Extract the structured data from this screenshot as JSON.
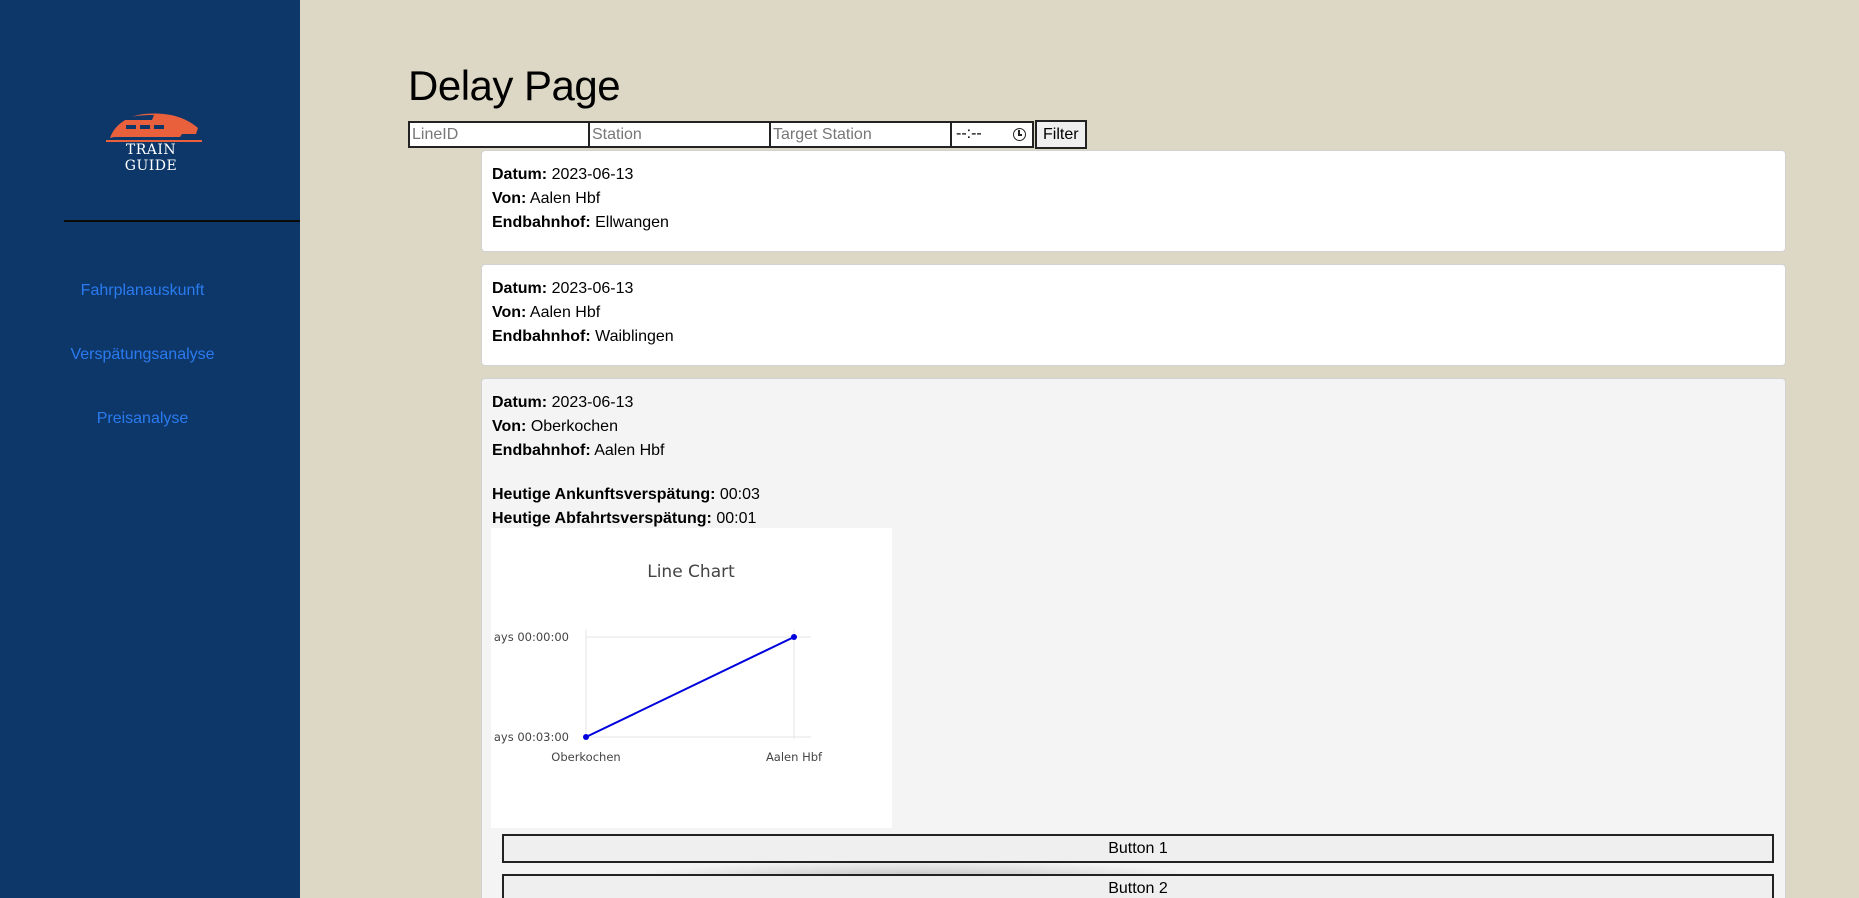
{
  "sidebar": {
    "logo_text": "TRAIN GUIDE",
    "nav": [
      {
        "label": "Fahrplanauskunft"
      },
      {
        "label": "Verspätungsanalyse"
      },
      {
        "label": "Preisanalyse"
      }
    ]
  },
  "page": {
    "title": "Delay Page"
  },
  "filter": {
    "line_placeholder": "LineID",
    "station_placeholder": "Station",
    "target_placeholder": "Target Station",
    "time_value": "--:--",
    "button_label": "Filter"
  },
  "labels": {
    "date": "Datum:",
    "from": "Von:",
    "end": "Endbahnhof:",
    "arrival_delay": "Heutige Ankunftsverspätung:",
    "departure_delay": "Heutige Abfahrtsverspätung:"
  },
  "trips": [
    {
      "date": "2023-06-13",
      "from": "Aalen Hbf",
      "end": "Ellwangen"
    },
    {
      "date": "2023-06-13",
      "from": "Aalen Hbf",
      "end": "Waiblingen"
    },
    {
      "date": "2023-06-13",
      "from": "Oberkochen",
      "end": "Aalen Hbf",
      "arrival_delay": "00:03",
      "departure_delay": "00:01"
    }
  ],
  "chart_data": {
    "type": "line",
    "title": "Line Chart",
    "categories": [
      "Oberkochen",
      "Aalen Hbf"
    ],
    "y_tick_labels": [
      "ays 00:00:00",
      "ays 00:03:00"
    ],
    "series": [
      {
        "values": [
          3,
          0
        ],
        "color": "#0000dd"
      }
    ],
    "y_unit": "minutes",
    "y_reversed": true,
    "ylim": [
      0,
      3
    ],
    "grid": true
  },
  "buttons": [
    {
      "label": "Button 1"
    },
    {
      "label": "Button 2"
    }
  ],
  "colors": {
    "sidebar": "#0d3769",
    "background": "#dcd8c5",
    "link": "#2b7bf0",
    "logo": "#e8603c",
    "line": "#0000dd"
  }
}
